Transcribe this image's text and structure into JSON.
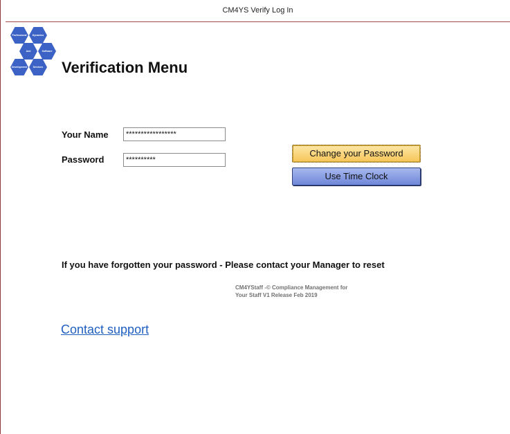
{
  "window": {
    "title": "CM4YS Verify Log In"
  },
  "logo": {
    "hexes": [
      "Professional",
      "Dynamics",
      "And",
      "Software",
      "Development",
      "Services"
    ]
  },
  "page": {
    "title": "Verification Menu"
  },
  "form": {
    "name_label": "Your Name",
    "name_value": "*****************",
    "password_label": "Password",
    "password_value": "**********"
  },
  "buttons": {
    "change_password": "Change your Password",
    "time_clock": "Use Time Clock"
  },
  "notice": {
    "forgot": "If you have forgotten your password - Please contact your Manager to reset",
    "copyright_line1": "CM4YStaff -© Compliance Management for",
    "copyright_line2": "Your Staff  V1 Release Feb 2019"
  },
  "links": {
    "support": "Contact support"
  },
  "colors": {
    "accent_blue": "#3b62c4",
    "button_gold": "#f6c557",
    "button_blue": "#6f87d8",
    "link": "#1f5fbf"
  }
}
